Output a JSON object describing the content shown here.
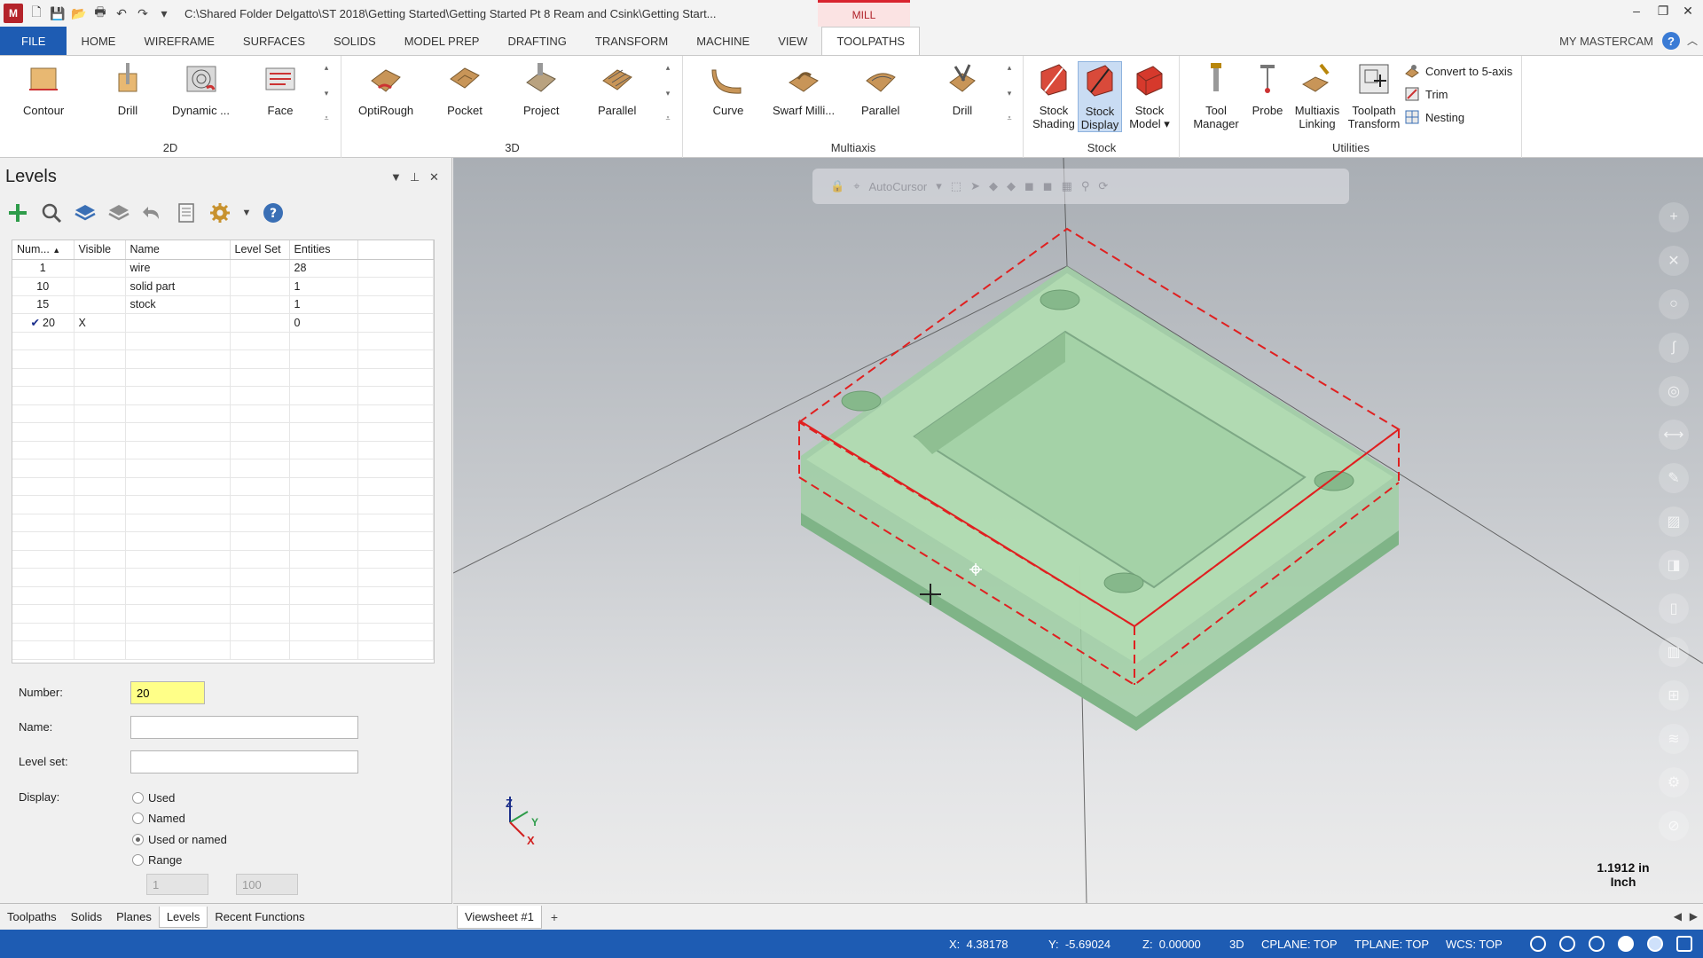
{
  "window": {
    "title": "C:\\Shared Folder Delgatto\\ST 2018\\Getting Started\\Getting Started Pt 8 Ream and Csink\\Getting Start...",
    "context_tab": "MILL",
    "controls": {
      "minimize": "–",
      "restore": "❐",
      "close": "✕"
    }
  },
  "ribbon_tabs": [
    "FILE",
    "HOME",
    "WIREFRAME",
    "SURFACES",
    "SOLIDS",
    "MODEL PREP",
    "DRAFTING",
    "TRANSFORM",
    "MACHINE",
    "VIEW",
    "TOOLPATHS"
  ],
  "active_tab": "TOOLPATHS",
  "my_mastercam": "MY MASTERCAM",
  "help": "?",
  "ribbon": {
    "groups": {
      "g2d": {
        "label": "2D",
        "buttons": [
          "Contour",
          "Drill",
          "Dynamic ...",
          "Face"
        ]
      },
      "g3d": {
        "label": "3D",
        "buttons": [
          "OptiRough",
          "Pocket",
          "Project",
          "Parallel"
        ]
      },
      "multiaxis": {
        "label": "Multiaxis",
        "buttons": [
          "Curve",
          "Swarf Milli...",
          "Parallel",
          "Drill"
        ]
      },
      "stock": {
        "label": "Stock",
        "buttons": [
          "Stock\nShading",
          "Stock\nDisplay",
          "Stock\nModel ▾"
        ]
      },
      "utilities": {
        "label": "Utilities",
        "buttons": [
          "Tool\nManager",
          "Probe",
          "Multiaxis\nLinking",
          "Toolpath\nTransform"
        ],
        "small": [
          "Convert to 5-axis",
          "Trim",
          "Nesting"
        ]
      }
    }
  },
  "levels": {
    "title": "Levels",
    "columns": [
      "Num...",
      "Visible",
      "Name",
      "Level Set",
      "Entities"
    ],
    "rows": [
      {
        "num": "1",
        "visible": "",
        "name": "wire",
        "level_set": "",
        "entities": "28",
        "active": false
      },
      {
        "num": "10",
        "visible": "",
        "name": "solid part",
        "level_set": "",
        "entities": "1",
        "active": false
      },
      {
        "num": "15",
        "visible": "",
        "name": "stock",
        "level_set": "",
        "entities": "1",
        "active": false
      },
      {
        "num": "20",
        "visible": "X",
        "name": "",
        "level_set": "",
        "entities": "0",
        "active": true
      }
    ],
    "form": {
      "number_label": "Number:",
      "number_value": "20",
      "name_label": "Name:",
      "name_value": "",
      "levelset_label": "Level set:",
      "levelset_value": "",
      "display_label": "Display:",
      "options": [
        "Used",
        "Named",
        "Used or named",
        "Range"
      ],
      "selected_option": "Used or named",
      "range_from": "1",
      "range_to": "100"
    }
  },
  "panel_tabs": [
    "Toolpaths",
    "Solids",
    "Planes",
    "Levels",
    "Recent Functions"
  ],
  "active_panel_tab": "Levels",
  "viewport": {
    "autocursor": "AutoCursor",
    "axes": {
      "z": "Z",
      "y": "Y",
      "x": "X"
    },
    "scale": {
      "value": "1.1912 in",
      "unit": "Inch"
    }
  },
  "viewsheet": {
    "tab": "Viewsheet #1",
    "add": "+"
  },
  "status": {
    "x_label": "X:",
    "x": "4.38178",
    "y_label": "Y:",
    "y": "-5.69024",
    "z_label": "Z:",
    "z": "0.00000",
    "mode": "3D",
    "cplane": "CPLANE: TOP",
    "tplane": "TPLANE: TOP",
    "wcs": "WCS: TOP"
  },
  "colors": {
    "accent": "#1e5cb3",
    "mill": "#d9232e",
    "part": "#8fc79a",
    "stock_outline": "#e02020"
  }
}
